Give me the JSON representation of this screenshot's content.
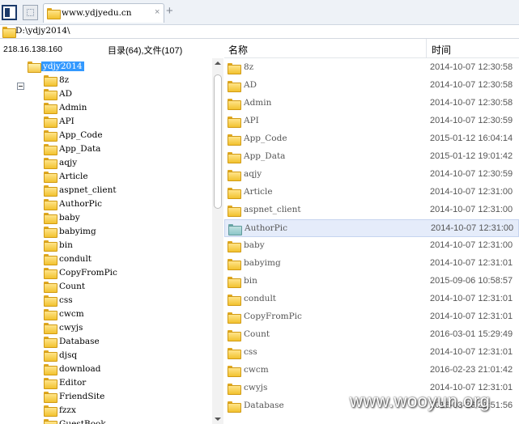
{
  "toolbar": {
    "tab_label": "www.ydjyedu.cn",
    "tab_close": "×",
    "new_tab": "+"
  },
  "path": "D:\\ydjy2014\\",
  "left": {
    "ip": "218.16.138.160",
    "counts": "目录(64),文件(107)",
    "root": "ydjy2014",
    "folders": [
      "8z",
      "AD",
      "Admin",
      "API",
      "App_Code",
      "App_Data",
      "aqjy",
      "Article",
      "aspnet_client",
      "AuthorPic",
      "baby",
      "babyimg",
      "bin",
      "condult",
      "CopyFromPic",
      "Count",
      "css",
      "cwcm",
      "cwyjs",
      "Database",
      "djsq",
      "download",
      "Editor",
      "FriendSite",
      "fzzx",
      "GuestBook"
    ]
  },
  "right": {
    "col_name": "名称",
    "col_time": "时间",
    "rows": [
      {
        "name": "8z",
        "time": "2014-10-07 12:30:58"
      },
      {
        "name": "AD",
        "time": "2014-10-07 12:30:58"
      },
      {
        "name": "Admin",
        "time": "2014-10-07 12:30:58"
      },
      {
        "name": "API",
        "time": "2014-10-07 12:30:59"
      },
      {
        "name": "App_Code",
        "time": "2015-01-12 16:04:14"
      },
      {
        "name": "App_Data",
        "time": "2015-01-12 19:01:42"
      },
      {
        "name": "aqjy",
        "time": "2014-10-07 12:30:59"
      },
      {
        "name": "Article",
        "time": "2014-10-07 12:31:00"
      },
      {
        "name": "aspnet_client",
        "time": "2014-10-07 12:31:00"
      },
      {
        "name": "AuthorPic",
        "time": "2014-10-07 12:31:00"
      },
      {
        "name": "baby",
        "time": "2014-10-07 12:31:00"
      },
      {
        "name": "babyimg",
        "time": "2014-10-07 12:31:01"
      },
      {
        "name": "bin",
        "time": "2015-09-06 10:58:57"
      },
      {
        "name": "condult",
        "time": "2014-10-07 12:31:01"
      },
      {
        "name": "CopyFromPic",
        "time": "2014-10-07 12:31:01"
      },
      {
        "name": "Count",
        "time": "2016-03-01 15:29:49"
      },
      {
        "name": "css",
        "time": "2014-10-07 12:31:01"
      },
      {
        "name": "cwcm",
        "time": "2016-02-23 21:01:42"
      },
      {
        "name": "cwyjs",
        "time": "2014-10-07 12:31:01"
      },
      {
        "name": "Database",
        "time": "2016-03-26 21:51:56"
      }
    ],
    "selected_index": 9
  },
  "watermark": "www.wooyun.org",
  "colors": {
    "accent": "#3399ff",
    "selection": "#e5ecfa",
    "folder": "#f2c230"
  }
}
